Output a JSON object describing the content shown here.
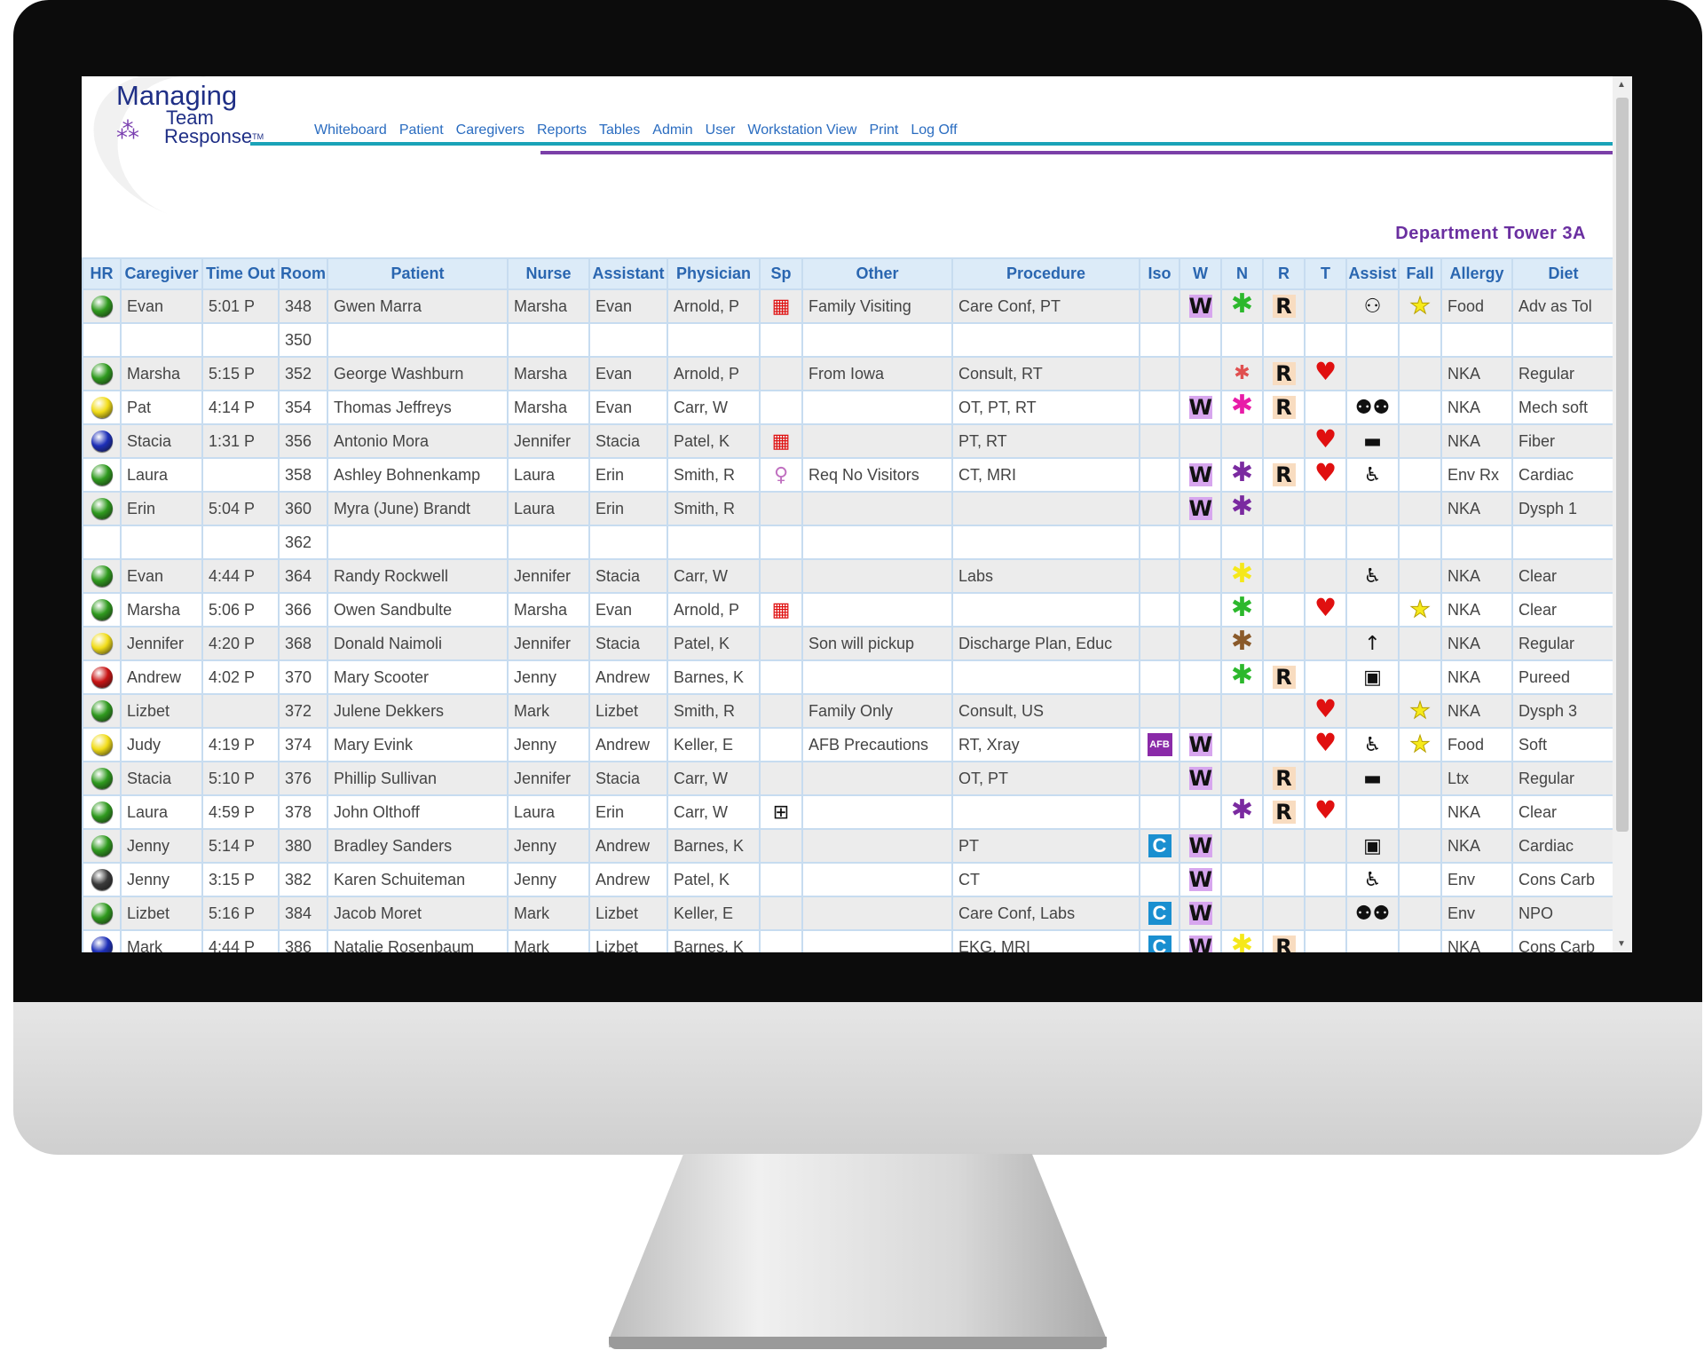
{
  "app": {
    "logo": {
      "line1": "Managing",
      "line2": "Team",
      "line3": "Response",
      "tm": "TM"
    },
    "nav": [
      "Whiteboard",
      "Patient",
      "Caregivers",
      "Reports",
      "Tables",
      "Admin",
      "User",
      "Workstation View",
      "Print",
      "Log Off"
    ],
    "department": "Department Tower 3A"
  },
  "colors": {
    "hr": {
      "green": "#2f9a1e",
      "yellow": "#f1dc18",
      "blue": "#1d2fb8",
      "red": "#c81414",
      "gray": "#3a3a3a"
    },
    "n": {
      "green": "#2cb82c",
      "magenta": "#e81ca8",
      "purple": "#7a2aa0",
      "yellow": "#f5e81a",
      "brown": "#8a5a2a",
      "multi": "#e05050"
    }
  },
  "columns": [
    "HR",
    "Caregiver",
    "Time Out",
    "Room",
    "Patient",
    "Nurse",
    "Assistant",
    "Physician",
    "Sp",
    "Other",
    "Procedure",
    "Iso",
    "W",
    "N",
    "R",
    "T",
    "Assist",
    "Fall",
    "Allergy",
    "Diet"
  ],
  "rows": [
    {
      "hr": "green",
      "caregiver": "Evan",
      "time": "5:01 P",
      "room": "348",
      "patient": "Gwen Marra",
      "nurse": "Marsha",
      "assistant": "Evan",
      "physician": "Arnold, P",
      "sp": "red-gift",
      "other": "Family Visiting",
      "procedure": "Care Conf, PT",
      "iso": "",
      "w": true,
      "n": "green",
      "r": true,
      "t": false,
      "assist": "assist-person",
      "fall": true,
      "allergy": "Food",
      "diet": "Adv as Tol"
    },
    {
      "hr": "",
      "caregiver": "",
      "time": "",
      "room": "350",
      "patient": "",
      "nurse": "",
      "assistant": "",
      "physician": "",
      "sp": "",
      "other": "",
      "procedure": "",
      "iso": "",
      "w": false,
      "n": "",
      "r": false,
      "t": false,
      "assist": "",
      "fall": false,
      "allergy": "",
      "diet": ""
    },
    {
      "hr": "green",
      "caregiver": "Marsha",
      "time": "5:15 P",
      "room": "352",
      "patient": "George Washburn",
      "nurse": "Marsha",
      "assistant": "Evan",
      "physician": "Arnold, P",
      "sp": "",
      "other": "From Iowa",
      "procedure": "Consult, RT",
      "iso": "",
      "w": false,
      "n": "multi",
      "r": true,
      "t": true,
      "assist": "",
      "fall": false,
      "allergy": "NKA",
      "diet": "Regular"
    },
    {
      "hr": "yellow",
      "caregiver": "Pat",
      "time": "4:14 P",
      "room": "354",
      "patient": "Thomas Jeffreys",
      "nurse": "Marsha",
      "assistant": "Evan",
      "physician": "Carr, W",
      "sp": "",
      "other": "",
      "procedure": "OT, PT, RT",
      "iso": "",
      "w": true,
      "n": "magenta",
      "r": true,
      "t": false,
      "assist": "group",
      "fall": false,
      "allergy": "NKA",
      "diet": "Mech soft"
    },
    {
      "hr": "blue",
      "caregiver": "Stacia",
      "time": "1:31 P",
      "room": "356",
      "patient": "Antonio Mora",
      "nurse": "Jennifer",
      "assistant": "Stacia",
      "physician": "Patel, K",
      "sp": "red-gift",
      "other": "",
      "procedure": "PT, RT",
      "iso": "",
      "w": false,
      "n": "",
      "r": false,
      "t": true,
      "assist": "bed",
      "fall": false,
      "allergy": "NKA",
      "diet": "Fiber"
    },
    {
      "hr": "green",
      "caregiver": "Laura",
      "time": "",
      "room": "358",
      "patient": "Ashley Bohnenkamp",
      "nurse": "Laura",
      "assistant": "Erin",
      "physician": "Smith, R",
      "sp": "ribbon",
      "other": "Req No Visitors",
      "procedure": "CT, MRI",
      "iso": "",
      "w": true,
      "n": "purple",
      "r": true,
      "t": true,
      "assist": "wheelchair",
      "fall": false,
      "allergy": "Env Rx",
      "diet": "Cardiac"
    },
    {
      "hr": "green",
      "caregiver": "Erin",
      "time": "5:04 P",
      "room": "360",
      "patient": "Myra (June) Brandt",
      "nurse": "Laura",
      "assistant": "Erin",
      "physician": "Smith, R",
      "sp": "",
      "other": "",
      "procedure": "",
      "iso": "",
      "w": true,
      "n": "purple",
      "r": false,
      "t": false,
      "assist": "",
      "fall": false,
      "allergy": "NKA",
      "diet": "Dysph 1"
    },
    {
      "hr": "",
      "caregiver": "",
      "time": "",
      "room": "362",
      "patient": "",
      "nurse": "",
      "assistant": "",
      "physician": "",
      "sp": "",
      "other": "",
      "procedure": "",
      "iso": "",
      "w": false,
      "n": "",
      "r": false,
      "t": false,
      "assist": "",
      "fall": false,
      "allergy": "",
      "diet": ""
    },
    {
      "hr": "green",
      "caregiver": "Evan",
      "time": "4:44 P",
      "room": "364",
      "patient": "Randy Rockwell",
      "nurse": "Jennifer",
      "assistant": "Stacia",
      "physician": "Carr, W",
      "sp": "",
      "other": "",
      "procedure": "Labs",
      "iso": "",
      "w": false,
      "n": "yellow",
      "r": false,
      "t": false,
      "assist": "sitting",
      "fall": false,
      "allergy": "NKA",
      "diet": "Clear"
    },
    {
      "hr": "green",
      "caregiver": "Marsha",
      "time": "5:06 P",
      "room": "366",
      "patient": "Owen Sandbulte",
      "nurse": "Marsha",
      "assistant": "Evan",
      "physician": "Arnold, P",
      "sp": "red-gift",
      "other": "",
      "procedure": "",
      "iso": "",
      "w": false,
      "n": "green",
      "r": false,
      "t": true,
      "assist": "",
      "fall": true,
      "allergy": "NKA",
      "diet": "Clear"
    },
    {
      "hr": "yellow",
      "caregiver": "Jennifer",
      "time": "4:20 P",
      "room": "368",
      "patient": "Donald Naimoli",
      "nurse": "Jennifer",
      "assistant": "Stacia",
      "physician": "Patel, K",
      "sp": "",
      "other": "Son will pickup",
      "procedure": "Discharge Plan, Educ",
      "iso": "",
      "w": false,
      "n": "brown",
      "r": false,
      "t": false,
      "assist": "arrow-up",
      "fall": false,
      "allergy": "NKA",
      "diet": "Regular"
    },
    {
      "hr": "red",
      "caregiver": "Andrew",
      "time": "4:02 P",
      "room": "370",
      "patient": "Mary Scooter",
      "nurse": "Jenny",
      "assistant": "Andrew",
      "physician": "Barnes, K",
      "sp": "",
      "other": "",
      "procedure": "",
      "iso": "",
      "w": false,
      "n": "green",
      "r": true,
      "t": false,
      "assist": "commode",
      "fall": false,
      "allergy": "NKA",
      "diet": "Pureed"
    },
    {
      "hr": "green",
      "caregiver": "Lizbet",
      "time": "",
      "room": "372",
      "patient": "Julene Dekkers",
      "nurse": "Mark",
      "assistant": "Lizbet",
      "physician": "Smith, R",
      "sp": "",
      "other": "Family Only",
      "procedure": "Consult, US",
      "iso": "",
      "w": false,
      "n": "",
      "r": false,
      "t": true,
      "assist": "",
      "fall": true,
      "allergy": "NKA",
      "diet": "Dysph 3"
    },
    {
      "hr": "yellow",
      "caregiver": "Judy",
      "time": "4:19 P",
      "room": "374",
      "patient": "Mary Evink",
      "nurse": "Jenny",
      "assistant": "Andrew",
      "physician": "Keller, E",
      "sp": "",
      "other": "AFB Precautions",
      "procedure": "RT, Xray",
      "iso": "AFB",
      "w": true,
      "n": "",
      "r": false,
      "t": true,
      "assist": "wheelchair",
      "fall": true,
      "allergy": "Food",
      "diet": "Soft"
    },
    {
      "hr": "green",
      "caregiver": "Stacia",
      "time": "5:10 P",
      "room": "376",
      "patient": "Phillip Sullivan",
      "nurse": "Jennifer",
      "assistant": "Stacia",
      "physician": "Carr, W",
      "sp": "",
      "other": "",
      "procedure": "OT, PT",
      "iso": "",
      "w": true,
      "n": "",
      "r": true,
      "t": false,
      "assist": "bed",
      "fall": false,
      "allergy": "Ltx",
      "diet": "Regular"
    },
    {
      "hr": "green",
      "caregiver": "Laura",
      "time": "4:59 P",
      "room": "378",
      "patient": "John Olthoff",
      "nurse": "Laura",
      "assistant": "Erin",
      "physician": "Carr, W",
      "sp": "outline-gift",
      "other": "",
      "procedure": "",
      "iso": "",
      "w": false,
      "n": "purple",
      "r": true,
      "t": true,
      "assist": "",
      "fall": false,
      "allergy": "NKA",
      "diet": "Clear"
    },
    {
      "hr": "green",
      "caregiver": "Jenny",
      "time": "5:14 P",
      "room": "380",
      "patient": "Bradley Sanders",
      "nurse": "Jenny",
      "assistant": "Andrew",
      "physician": "Barnes, K",
      "sp": "",
      "other": "",
      "procedure": "PT",
      "iso": "C",
      "w": true,
      "n": "",
      "r": false,
      "t": false,
      "assist": "commode",
      "fall": false,
      "allergy": "NKA",
      "diet": "Cardiac"
    },
    {
      "hr": "gray",
      "caregiver": "Jenny",
      "time": "3:15 P",
      "room": "382",
      "patient": "Karen Schuiteman",
      "nurse": "Jenny",
      "assistant": "Andrew",
      "physician": "Patel, K",
      "sp": "",
      "other": "",
      "procedure": "CT",
      "iso": "",
      "w": true,
      "n": "",
      "r": false,
      "t": false,
      "assist": "sitting",
      "fall": false,
      "allergy": "Env",
      "diet": "Cons Carb"
    },
    {
      "hr": "green",
      "caregiver": "Lizbet",
      "time": "5:16 P",
      "room": "384",
      "patient": "Jacob Moret",
      "nurse": "Mark",
      "assistant": "Lizbet",
      "physician": "Keller, E",
      "sp": "",
      "other": "",
      "procedure": "Care Conf, Labs",
      "iso": "C",
      "w": true,
      "n": "",
      "r": false,
      "t": false,
      "assist": "group",
      "fall": false,
      "allergy": "Env",
      "diet": "NPO"
    },
    {
      "hr": "blue",
      "caregiver": "Mark",
      "time": "4:44 P",
      "room": "386",
      "patient": "Natalie Rosenbaum",
      "nurse": "Mark",
      "assistant": "Lizbet",
      "physician": "Barnes, K",
      "sp": "",
      "other": "",
      "procedure": "EKG, MRI",
      "iso": "C",
      "w": true,
      "n": "yellow",
      "r": true,
      "t": false,
      "assist": "",
      "fall": false,
      "allergy": "NKA",
      "diet": "Cons Carb"
    }
  ],
  "symbols": {
    "w": "W",
    "r": "R"
  }
}
